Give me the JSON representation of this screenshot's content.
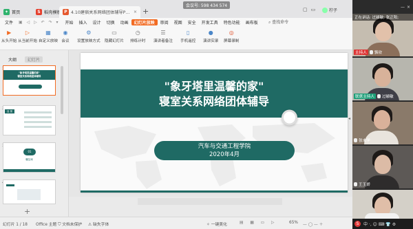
{
  "tabs": [
    {
      "icon": "home-icon",
      "label": "首页"
    },
    {
      "icon": "template-icon",
      "label": "稻壳模板"
    },
    {
      "icon": "ppt-icon",
      "label": "4.10建宿关系网络团体辅导PPT"
    }
  ],
  "meeting_id": "会议号: 598 434 574",
  "current_user": "柠子",
  "menu": {
    "file": "文件",
    "icons": "▣ ◁ ▷ ↶ ↷ ▾",
    "items": [
      "开始",
      "插入",
      "设计",
      "切换",
      "动画",
      "幻灯片放映",
      "审阅",
      "视图",
      "安全",
      "开发工具",
      "特色功能",
      "画布板"
    ],
    "active": "幻灯片放映",
    "search": "查找命令"
  },
  "ribbon": [
    {
      "label": "从头开始",
      "icon": "play-icon",
      "color": "#f26b22"
    },
    {
      "label": "从当前开始",
      "icon": "play-current-icon",
      "color": "#f26b22"
    },
    {
      "label": "自定义放映",
      "icon": "custom-show-icon",
      "color": "#4a86c8"
    },
    {
      "label": "会议",
      "icon": "meeting-icon",
      "color": "#4a86c8"
    },
    {
      "label": "设置放映方式",
      "icon": "settings-icon",
      "color": "#4a86c8"
    },
    {
      "label": "隐藏幻灯片",
      "icon": "hide-slide-icon",
      "color": "#777777"
    },
    {
      "label": "排练计时",
      "icon": "timer-icon",
      "color": "#777777"
    },
    {
      "label": "演讲者备注",
      "icon": "notes-icon",
      "color": "#777777"
    },
    {
      "label": "手机遥控",
      "icon": "phone-icon",
      "color": "#4a86c8"
    },
    {
      "label": "演讲实录",
      "icon": "record-icon",
      "color": "#4a86c8"
    },
    {
      "label": "屏幕录制",
      "icon": "screen-record-icon",
      "color": "#e0532d"
    }
  ],
  "left_pane": {
    "tab_outline": "大纲",
    "tab_slides": "幻灯片",
    "thumbs": [
      {
        "num": "1",
        "title": "\"象牙塔里温馨的家\"",
        "subtitle": "寝室关系网络团体辅导"
      },
      {
        "num": "2",
        "title": "目 录",
        "subtitle": ""
      },
      {
        "num": "3",
        "title": "01",
        "subtitle": "暖互戏"
      },
      {
        "num": "4",
        "title": "",
        "subtitle": ""
      }
    ]
  },
  "slide": {
    "title_line1": "\"象牙塔里温馨的家\"",
    "title_line2": "寝室关系网络团体辅导",
    "org": "汽车与交通工程学院",
    "date": "2020年4月"
  },
  "status": {
    "slide_count": "幻灯片 1 / 18",
    "theme": "Office 主题",
    "backup": "文档未保护",
    "missing_font": "缺失字体",
    "beautify": "一键美化",
    "zoom": "65%"
  },
  "video_panel": {
    "speaking_label": "正在讲话: 过颖敏; 张正阳;",
    "participants": [
      {
        "name": "骆欣",
        "role": "主持人",
        "role_color": "#d33333"
      },
      {
        "name": "过颖敏",
        "role": "联席主持人",
        "role_color": "#1b9e77"
      },
      {
        "name": "张未学",
        "role": "",
        "role_color": ""
      },
      {
        "name": "王玉娇",
        "role": "",
        "role_color": ""
      },
      {
        "name": "",
        "role": "",
        "role_color": ""
      }
    ],
    "taskbar_text": "中 ·, 😊 ⌨ 👕 ⚙"
  },
  "colors": {
    "accent": "#f26b22",
    "slide_teal": "#1f6a64"
  }
}
